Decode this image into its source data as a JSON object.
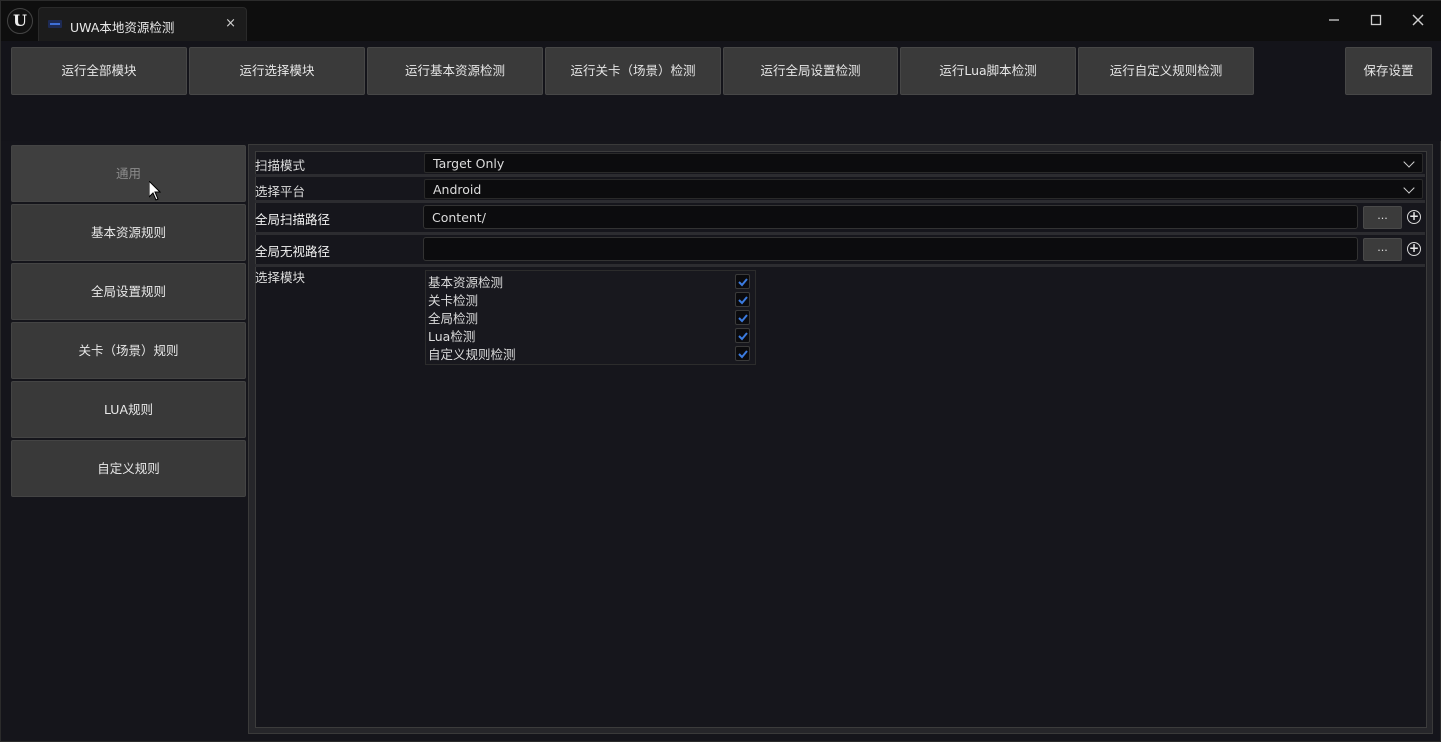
{
  "window": {
    "logo_text": "U",
    "tab_title": "UWA本地资源检测",
    "tab_close": "×",
    "controls": {
      "minimize": "—",
      "maximize": "☐",
      "close": "✕"
    }
  },
  "toolbar": {
    "buttons": [
      "运行全部模块",
      "运行选择模块",
      "运行基本资源检测",
      "运行关卡（场景）检测",
      "运行全局设置检测",
      "运行Lua脚本检测",
      "运行自定义规则检测"
    ],
    "save_label": "保存设置"
  },
  "sidebar": {
    "active_index": 0,
    "items": [
      {
        "label": "通用"
      },
      {
        "label": "基本资源规则"
      },
      {
        "label": "全局设置规则"
      },
      {
        "label": "关卡（场景）规则"
      },
      {
        "label": "LUA规则"
      },
      {
        "label": "自定义规则"
      }
    ]
  },
  "settings": {
    "scan_mode": {
      "label": "扫描模式",
      "value": "Target Only"
    },
    "platform": {
      "label": "选择平台",
      "value": "Android"
    },
    "scan_path": {
      "label": "全局扫描路径",
      "value": "Content/",
      "browse": "..."
    },
    "ignore_path": {
      "label": "全局无视路径",
      "value": "",
      "browse": "..."
    },
    "modules": {
      "label": "选择模块",
      "items": [
        {
          "label": "基本资源检测",
          "checked": true
        },
        {
          "label": "关卡检测",
          "checked": true
        },
        {
          "label": "全局检测",
          "checked": true
        },
        {
          "label": "Lua检测",
          "checked": true
        },
        {
          "label": "自定义规则检测",
          "checked": true
        }
      ]
    }
  },
  "colors": {
    "checkmark": "#3b7be0",
    "button_bg": "#3a3a3a",
    "background": "#15151b"
  }
}
